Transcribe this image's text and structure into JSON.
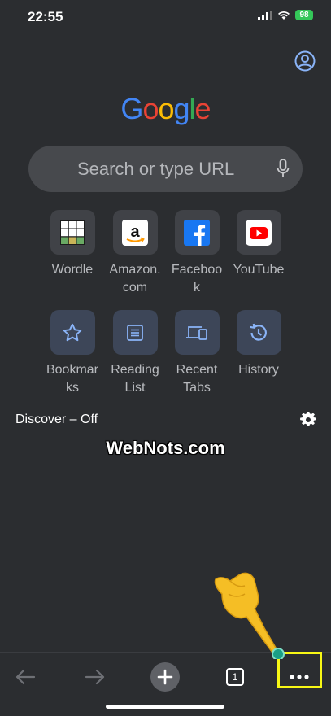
{
  "status": {
    "time": "22:55",
    "battery": "98"
  },
  "logo": {
    "letters": [
      "G",
      "o",
      "o",
      "g",
      "l",
      "e"
    ],
    "colors": [
      "#4285f4",
      "#ea4335",
      "#fbbc05",
      "#4285f4",
      "#34a853",
      "#ea4335"
    ]
  },
  "search": {
    "placeholder": "Search or type URL"
  },
  "shortcuts": [
    {
      "label": "Wordle",
      "icon": "wordle-icon"
    },
    {
      "label": "Amazon.\ncom",
      "icon": "amazon-icon"
    },
    {
      "label": "Faceboo\nk",
      "icon": "facebook-icon"
    },
    {
      "label": "YouTube",
      "icon": "youtube-icon"
    }
  ],
  "actions": [
    {
      "label": "Bookmar\nks",
      "icon": "star-icon"
    },
    {
      "label": "Reading\nList",
      "icon": "reading-list-icon"
    },
    {
      "label": "Recent\nTabs",
      "icon": "recent-tabs-icon"
    },
    {
      "label": "History",
      "icon": "history-icon"
    }
  ],
  "discover": {
    "label": "Discover – Off"
  },
  "watermark": "WebNots.com",
  "toolbar": {
    "tab_count": "1"
  },
  "colors": {
    "background": "#2b2d30",
    "highlight": "#f7f715",
    "pointer": "#f5be25",
    "accent_blue": "#8ab4f8"
  }
}
